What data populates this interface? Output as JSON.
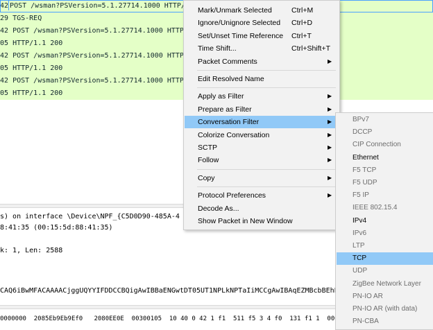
{
  "packet_list": {
    "rows": [
      {
        "no": "42",
        "info": "POST /wsman?PSVersion=5.1.27714.1000 HTTP/",
        "style": "sel"
      },
      {
        "no": "29",
        "info": "TGS-REQ",
        "style": "green"
      },
      {
        "no": "42",
        "info": "POST /wsman?PSVersion=5.1.27714.1000 HTTP/",
        "style": "green"
      },
      {
        "no": "05",
        "info": "HTTP/1.1 200",
        "style": "green"
      },
      {
        "no": "42",
        "info": "POST /wsman?PSVersion=5.1.27714.1000 HTTP/",
        "style": "green"
      },
      {
        "no": "05",
        "info": "HTTP/1.1 200",
        "style": "green"
      },
      {
        "no": "42",
        "info": "POST /wsman?PSVersion=5.1.27714.1000 HTTP/",
        "style": "green"
      },
      {
        "no": "05",
        "info": "HTTP/1.1 200",
        "style": "green"
      }
    ]
  },
  "details": {
    "lines": [
      "s) on interface \\Device\\NPF_{C5D0D90-485A-4",
      "8:41:35 (00:15:5d:88:41:35)",
      "",
      "k: 1, Len: 2588",
      "",
      "",
      "",
      "CAQ6iBwMFACAAAACjggUQYYIFDDCCBQigAwIBBaENGwtDT05UT1NPLkNPTaIiMCCgAwIBAqEZMBcbBEhPU1"
    ]
  },
  "bytes": {
    "line": "0000000  2085Eb9Eb9Ef0   2080EE0E  00300105  10 40 0 42 1 f1  511 f5 3 4 f0  131 f1 1  0003000  00"
  },
  "context_menu": {
    "items": [
      {
        "label": "Mark/Unmark Selected",
        "shortcut": "Ctrl+M"
      },
      {
        "label": "Ignore/Unignore Selected",
        "shortcut": "Ctrl+D"
      },
      {
        "label": "Set/Unset Time Reference",
        "shortcut": "Ctrl+T"
      },
      {
        "label": "Time Shift...",
        "shortcut": "Ctrl+Shift+T"
      },
      {
        "label": "Packet Comments",
        "submenu": true
      },
      {
        "separator": true
      },
      {
        "label": "Edit Resolved Name"
      },
      {
        "separator": true
      },
      {
        "label": "Apply as Filter",
        "submenu": true
      },
      {
        "label": "Prepare as Filter",
        "submenu": true
      },
      {
        "label": "Conversation Filter",
        "submenu": true,
        "highlighted": true
      },
      {
        "label": "Colorize Conversation",
        "submenu": true
      },
      {
        "label": "SCTP",
        "submenu": true
      },
      {
        "label": "Follow",
        "submenu": true
      },
      {
        "separator": true
      },
      {
        "label": "Copy",
        "submenu": true
      },
      {
        "separator": true
      },
      {
        "label": "Protocol Preferences",
        "submenu": true
      },
      {
        "label": "Decode As..."
      },
      {
        "label": "Show Packet in New Window"
      }
    ]
  },
  "conversation_submenu": {
    "items": [
      {
        "label": "BPv7",
        "enabled": false
      },
      {
        "label": "DCCP",
        "enabled": false
      },
      {
        "label": "CIP Connection",
        "enabled": false
      },
      {
        "label": "Ethernet",
        "enabled": true
      },
      {
        "label": "F5 TCP",
        "enabled": false
      },
      {
        "label": "F5 UDP",
        "enabled": false
      },
      {
        "label": "F5 IP",
        "enabled": false
      },
      {
        "label": "IEEE 802.15.4",
        "enabled": false
      },
      {
        "label": "IPv4",
        "enabled": true
      },
      {
        "label": "IPv6",
        "enabled": false
      },
      {
        "label": "LTP",
        "enabled": false
      },
      {
        "label": "TCP",
        "enabled": true,
        "highlighted": true
      },
      {
        "label": "UDP",
        "enabled": false
      },
      {
        "label": "ZigBee Network Layer",
        "enabled": false
      },
      {
        "label": "PN-IO AR",
        "enabled": false
      },
      {
        "label": "PN-IO AR (with data)",
        "enabled": false
      },
      {
        "label": "PN-CBA",
        "enabled": false
      }
    ]
  },
  "colors": {
    "row_green": "#e4ffc7",
    "selection_outline": "#4aa0ff",
    "menu_bg": "#f2f2f2",
    "menu_highlight": "#91c9f7",
    "disabled_text": "#6d6d6d"
  }
}
